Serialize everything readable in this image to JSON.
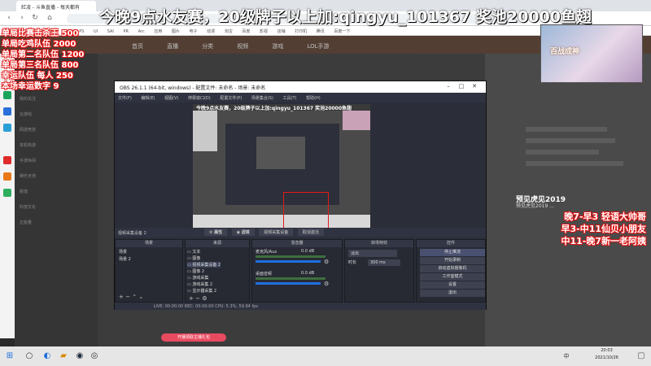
{
  "browser": {
    "tab_title": "紅凌 - 斗鱼直播 - 每天都有",
    "bookmarks": [
      "社区",
      "PUBG",
      "H1Z1",
      "LOL",
      "PS",
      "UI",
      "SAI",
      "PR",
      "Arc",
      "应用",
      "图片",
      "电子",
      "动漫",
      "淘宝",
      "百度",
      "影视",
      "店铺",
      "打印机",
      "腾讯",
      "百度一下"
    ]
  },
  "site": {
    "nav": [
      "首页",
      "直播",
      "分类",
      "视频",
      "游戏",
      "LOL手游"
    ],
    "left_sidebar": [
      "我的关注",
      "云游戏",
      "网游竞技",
      "单机热游",
      "手游休闲",
      "娱乐天地",
      "颜值",
      "科技文化",
      "正能量"
    ],
    "promo": "开播领取主播礼包"
  },
  "overlay": {
    "headline": "今晚9点水友赛，20级牌子以上加:qingyu_101367 奖池20000鱼翅",
    "prize_lines": [
      "单局比赛击杀王  500",
      "单局吃鸡队伍  2000",
      "单局第二名队伍  1200",
      "单局第三名队伍  800",
      "幸运队伍 每人 250",
      "本场幸运数字 9"
    ],
    "schedule_lines": [
      "晚7-早3 轻语大帅哥",
      "早3-中11仙贝小朋友",
      "中11-晚7新一老阿姨"
    ],
    "avatar_logo": "百战成神",
    "event_badge": "预见虎见2019",
    "event_sub": "预见虎见2019 ..."
  },
  "obs": {
    "title": "OBS 26.1.1 (64-bit, windows) - 配置文件: 未命名 - 场景: 未命名",
    "menu": [
      "文件(F)",
      "编辑(E)",
      "视图(V)",
      "停靠窗口(D)",
      "配置文件(P)",
      "场景集合(S)",
      "工具(T)",
      "帮助(H)"
    ],
    "nested_title": "今晚9点水友赛，20级牌子以上加:qingyu_101367 奖池20000鱼翅",
    "preview_buttons": [
      "属性",
      "滤镜",
      "视频采集设备",
      "取消激活"
    ],
    "scenes_header": "场景",
    "scenes": [
      "场景",
      "场景 2"
    ],
    "sources_header": "来源",
    "sources": [
      "文本",
      "图像",
      "视频采集设备 2",
      "图像 2",
      "游戏采集",
      "游戏采集 2",
      "显示器采集 2"
    ],
    "mixer_header": "混音器",
    "mixer": [
      {
        "name": "麦克风/Aux",
        "db": "0.0 dB"
      },
      {
        "name": "桌面音频",
        "db": "0.0 dB"
      }
    ],
    "transitions_header": "转场特效",
    "transition_value": "淡出",
    "duration_label": "时长",
    "duration_value": "300 ms",
    "controls_header": "控件",
    "controls": [
      "停止推流",
      "开始录制",
      "启动虚拟摄像机",
      "工作室模式",
      "设置",
      "退出"
    ],
    "status": "LIVE: 00:00:00   REC: 00:00:00   CPU: 5.3%, 59.94 fps",
    "prev_label": "视频采集设备 2"
  },
  "taskbar": {
    "time": "20:03",
    "date": "2021/10/26",
    "lang": "中"
  }
}
